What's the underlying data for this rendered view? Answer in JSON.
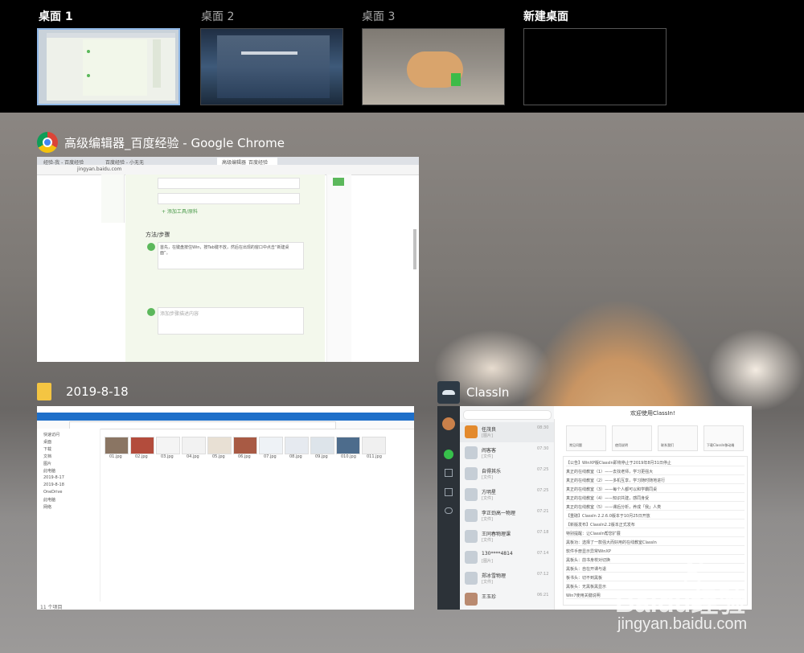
{
  "desktops": [
    {
      "label": "桌面 1",
      "selected": true
    },
    {
      "label": "桌面 2",
      "selected": false
    },
    {
      "label": "桌面 3",
      "selected": false
    },
    {
      "label": "新建桌面",
      "selected": false
    }
  ],
  "windows": {
    "chrome": {
      "title": "高级编辑器_百度经验 - Google Chrome",
      "icon": "chrome-icon",
      "tab1": "经验-我 - 百度经验",
      "tab2": "百度经验 - 小无无",
      "tab3": "高级编辑器_百度经验",
      "url": "jingyan.baidu.com",
      "menu_cn": "方法/步骤",
      "add_tool": "+ 添加工具/原料",
      "step1": "首先，在键盘按住Win，按Tab键不放，然后在出现的窗口中点击“新建桌面”。",
      "step2": "添加步骤描述内容"
    },
    "explorer": {
      "title": "2019-8-18",
      "icon": "folder-icon",
      "files": [
        "01.jpg",
        "02.jpg",
        "03.jpg",
        "04.jpg",
        "05.jpg",
        "06.jpg",
        "07.jpg",
        "08.jpg",
        "09.jpg",
        "010.jpg",
        "011.jpg"
      ],
      "sidebar": [
        "快速访问",
        "桌面",
        "下载",
        "文档",
        "图片",
        "此电脑",
        "2019-8-17",
        "2019-8-18",
        "OneDrive",
        "此电脑",
        "网络"
      ],
      "status": "11 个项目"
    },
    "classin": {
      "title": "ClassIn",
      "icon": "classin-icon",
      "welcome": "欢迎使用ClassIn!",
      "contacts": [
        {
          "name": "任茂良",
          "sub": "[图片]",
          "time": "08:30"
        },
        {
          "name": "闹客客",
          "sub": "[文件]",
          "time": "07:30"
        },
        {
          "name": "自得其乐",
          "sub": "[文件]",
          "time": "07:25"
        },
        {
          "name": "方明星",
          "sub": "[文件]",
          "time": "07:25"
        },
        {
          "name": "李正劲高一物理",
          "sub": "[文件]",
          "time": "07:21"
        },
        {
          "name": "王同春物理课",
          "sub": "[文件]",
          "time": "07:18"
        },
        {
          "name": "130****4814",
          "sub": "[图片]",
          "time": "07:14"
        },
        {
          "name": "郑冰雪物理",
          "sub": "[文件]",
          "time": "07:12"
        },
        {
          "name": "王玉珍",
          "sub": "",
          "time": "06:21"
        }
      ],
      "actions": [
        "常见问题",
        "使用说明",
        "联系我们",
        "下载ClassIn移动端"
      ],
      "notices": [
        "【公告】WinXP版ClassIn即将停止于2019年8月31日停止",
        "真正的在线教室（1）——去找老师，学习更强大",
        "真正的在线教室（2）——多机互享，学习随时随地进行",
        "真正的在线教室（3）——每个人都可以和学霸同桌",
        "真正的在线教室（4）——知识共建，感同身受",
        "真正的在线教室（5）——课后分析，养成「我」人类",
        "【重磅】ClassIn 2.2.6.0版本于10月25日开放",
        "【新版发布】ClassIn2.2版本正式发布",
        "特别提醒：让ClassIn帮您扩展",
        "黑板功：选择了一款强大而好用的在线教室ClassIn",
        "软件手册显示异常WinXP",
        "黑板头：前书身校对切换",
        "黑板头：自在开课与退",
        "板书头：切不到黑板",
        "黑板头：无黑板黑显示",
        "Win7使用关键说明"
      ]
    }
  },
  "watermark": {
    "brand": "Baidu经验",
    "url": "jingyan.baidu.com"
  }
}
